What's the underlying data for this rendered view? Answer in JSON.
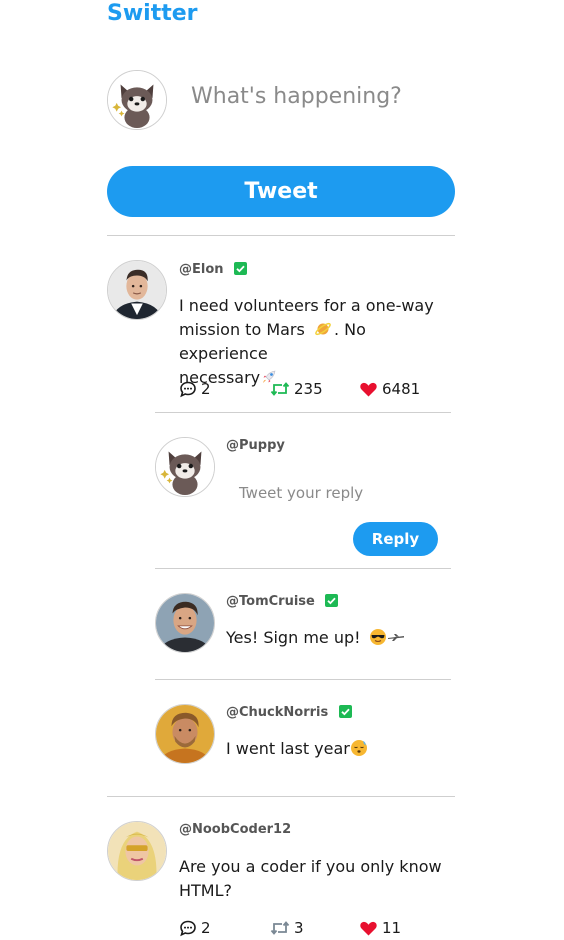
{
  "brand": "Switter",
  "compose": {
    "placeholder": "What's happening?",
    "button_label": "Tweet"
  },
  "colors": {
    "accent": "#1d9bf0",
    "verified": "#1db954",
    "retweet": "#1db954",
    "like": "#e0245e"
  },
  "posts": [
    {
      "handle": "@Elon",
      "verified": true,
      "text": "I need volunteers for a one-way mission to Mars 🪐. No experience necessary🚀",
      "text_lines": [
        "I need volunteers for a one-way",
        "mission to Mars",
        ". No experience",
        "necessary"
      ],
      "stats": {
        "replies": "2",
        "retweets": "235",
        "likes": "6481"
      },
      "reply_box": {
        "handle": "@Puppy",
        "placeholder": "Tweet your reply",
        "button_label": "Reply"
      },
      "replies": [
        {
          "handle": "@TomCruise",
          "verified": true,
          "text": "Yes! Sign me up!"
        },
        {
          "handle": "@ChuckNorris",
          "verified": true,
          "text": "I went last year"
        }
      ]
    },
    {
      "handle": "@NoobCoder12",
      "verified": false,
      "text": "Are you a coder if you only know HTML?",
      "text_lines": [
        "Are you a coder if you only know",
        "HTML?"
      ],
      "stats": {
        "replies": "2",
        "retweets": "3",
        "likes": "11"
      }
    }
  ]
}
